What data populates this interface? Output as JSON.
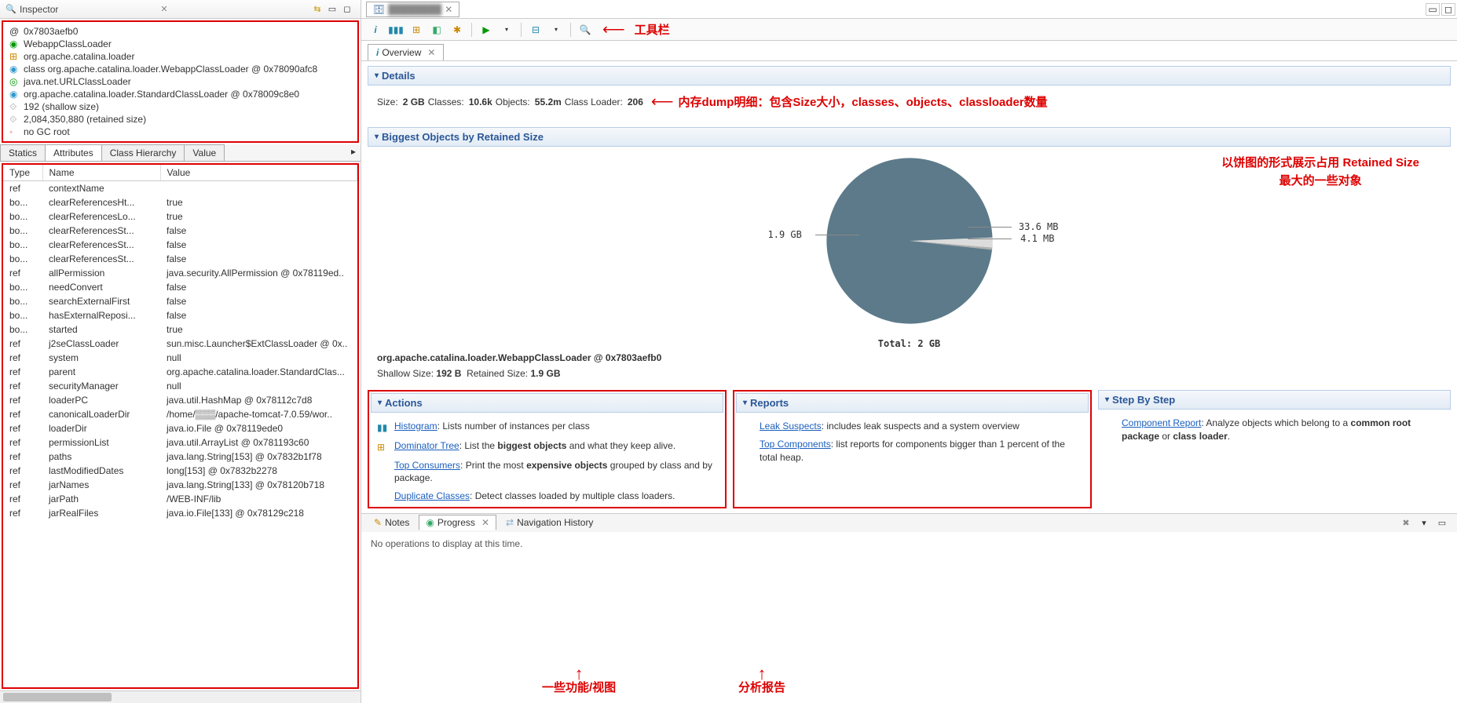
{
  "inspector": {
    "title": "Inspector",
    "items": [
      "0x7803aefb0",
      "WebappClassLoader",
      "org.apache.catalina.loader",
      "class org.apache.catalina.loader.WebappClassLoader @ 0x78090afc8",
      "java.net.URLClassLoader",
      "org.apache.catalina.loader.StandardClassLoader @ 0x78009c8e0",
      "192 (shallow size)",
      "2,084,350,880 (retained size)",
      "no GC root"
    ]
  },
  "attr_tabs": [
    "Statics",
    "Attributes",
    "Class Hierarchy",
    "Value"
  ],
  "attr_headers": [
    "Type",
    "Name",
    "Value"
  ],
  "attributes": [
    {
      "type": "ref",
      "name": "contextName",
      "value": ""
    },
    {
      "type": "bo...",
      "name": "clearReferencesHt...",
      "value": "true"
    },
    {
      "type": "bo...",
      "name": "clearReferencesLo...",
      "value": "true"
    },
    {
      "type": "bo...",
      "name": "clearReferencesSt...",
      "value": "false"
    },
    {
      "type": "bo...",
      "name": "clearReferencesSt...",
      "value": "false"
    },
    {
      "type": "bo...",
      "name": "clearReferencesSt...",
      "value": "false"
    },
    {
      "type": "ref",
      "name": "allPermission",
      "value": "java.security.AllPermission @ 0x78119ed.."
    },
    {
      "type": "bo...",
      "name": "needConvert",
      "value": "false"
    },
    {
      "type": "bo...",
      "name": "searchExternalFirst",
      "value": "false"
    },
    {
      "type": "bo...",
      "name": "hasExternalReposi...",
      "value": "false"
    },
    {
      "type": "bo...",
      "name": "started",
      "value": "true"
    },
    {
      "type": "ref",
      "name": "j2seClassLoader",
      "value": "sun.misc.Launcher$ExtClassLoader @ 0x.."
    },
    {
      "type": "ref",
      "name": "system",
      "value": "null"
    },
    {
      "type": "ref",
      "name": "parent",
      "value": "org.apache.catalina.loader.StandardClas..."
    },
    {
      "type": "ref",
      "name": "securityManager",
      "value": "null"
    },
    {
      "type": "ref",
      "name": "loaderPC",
      "value": "java.util.HashMap @ 0x78112c7d8"
    },
    {
      "type": "ref",
      "name": "canonicalLoaderDir",
      "value": "/home/▒▒▒/apache-tomcat-7.0.59/wor.."
    },
    {
      "type": "ref",
      "name": "loaderDir",
      "value": "java.io.File @ 0x78119ede0"
    },
    {
      "type": "ref",
      "name": "permissionList",
      "value": "java.util.ArrayList @ 0x781193c60"
    },
    {
      "type": "ref",
      "name": "paths",
      "value": "java.lang.String[153] @ 0x7832b1f78"
    },
    {
      "type": "ref",
      "name": "lastModifiedDates",
      "value": "long[153] @ 0x7832b2278"
    },
    {
      "type": "ref",
      "name": "jarNames",
      "value": "java.lang.String[133] @ 0x78120b718"
    },
    {
      "type": "ref",
      "name": "jarPath",
      "value": "/WEB-INF/lib"
    },
    {
      "type": "ref",
      "name": "jarRealFiles",
      "value": "java.io.File[133] @ 0x78129c218"
    }
  ],
  "overview": {
    "tab_label": "Overview",
    "toolbar_annotation": "工具栏",
    "details": {
      "header": "Details",
      "size_lbl": "Size:",
      "size_val": "2 GB",
      "classes_lbl": "Classes:",
      "classes_val": "10.6k",
      "objects_lbl": "Objects:",
      "objects_val": "55.2m",
      "classloader_lbl": "Class Loader:",
      "classloader_val": "206",
      "annotation": "内存dump明细：包含Size大小，classes、objects、classloader数量"
    },
    "pie": {
      "header": "Biggest Objects by Retained Size",
      "total_lbl": "Total: 2 GB",
      "slice1_lbl": "1.9 GB",
      "slice2_lbl": "33.6 MB",
      "slice3_lbl": "4.1 MB",
      "annotation_l1": "以饼图的形式展示占用 Retained Size",
      "annotation_l2": "最大的一些对象",
      "obj_name": "org.apache.catalina.loader.WebappClassLoader @ 0x7803aefb0",
      "shallow_lbl": "Shallow Size:",
      "shallow_val": "192 B",
      "retained_lbl": "Retained Size:",
      "retained_val": "1.9 GB"
    },
    "actions": {
      "header": "Actions",
      "items": [
        {
          "link": "Histogram",
          "text": ": Lists number of instances per class"
        },
        {
          "link": "Dominator Tree",
          "text": ": List the ",
          "bold": "biggest objects",
          "text2": " and what they keep alive."
        },
        {
          "link": "Top Consumers",
          "text": ": Print the most ",
          "bold": "expensive objects",
          "text2": " grouped by class and by package."
        },
        {
          "link": "Duplicate Classes",
          "text": ": Detect classes loaded by multiple class loaders."
        }
      ],
      "annotation": "一些功能/视图"
    },
    "reports": {
      "header": "Reports",
      "items": [
        {
          "link": "Leak Suspects",
          "text": ": includes leak suspects and a system overview"
        },
        {
          "link": "Top Components",
          "text": ": list reports for components bigger than 1 percent of the total heap."
        }
      ],
      "annotation": "分析报告"
    },
    "step": {
      "header": "Step By Step",
      "link": "Component Report",
      "text": ": Analyze objects which belong to a ",
      "bold1": "common root package",
      "text2": " or ",
      "bold2": "class loader",
      "text3": "."
    }
  },
  "bottom": {
    "tabs": [
      "Notes",
      "Progress",
      "Navigation History"
    ],
    "body": "No operations to display at this time."
  },
  "chart_data": {
    "type": "pie",
    "title": "Biggest Objects by Retained Size",
    "total": "2 GB",
    "slices": [
      {
        "label": "1.9 GB",
        "value_mb": 1945.6,
        "color": "#5c7a8a"
      },
      {
        "label": "33.6 MB",
        "value_mb": 33.6,
        "color": "#dcdcdc"
      },
      {
        "label": "4.1 MB",
        "value_mb": 4.1,
        "color": "#b0b0b0"
      }
    ]
  }
}
